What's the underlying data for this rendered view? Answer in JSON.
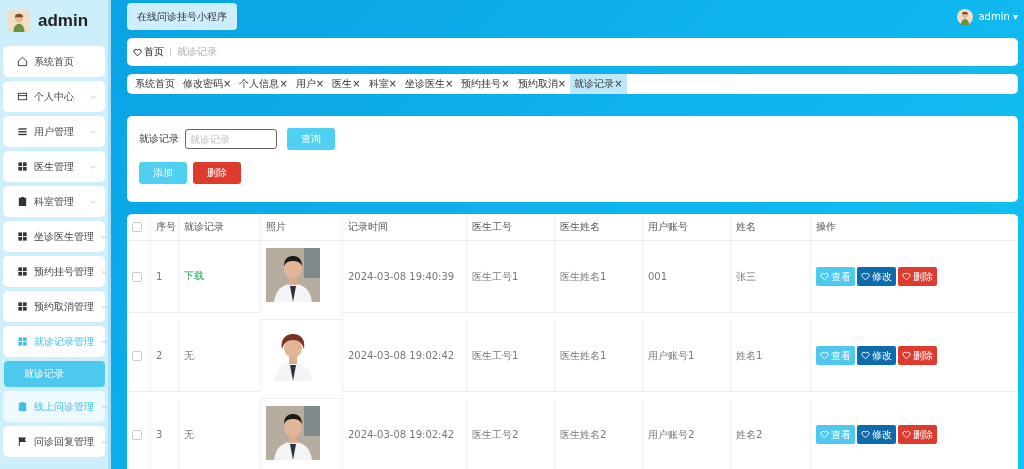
{
  "sidebar": {
    "user": "admin",
    "items": [
      {
        "label": "系统首页",
        "selected": false,
        "hovered": false
      },
      {
        "label": "个人中心",
        "selected": false,
        "hovered": false,
        "expanded": false
      },
      {
        "label": "用户管理",
        "selected": false,
        "hovered": false,
        "expanded": false
      },
      {
        "label": "医生管理",
        "selected": false,
        "hovered": false,
        "expanded": false
      },
      {
        "label": "科室管理",
        "selected": false,
        "hovered": false,
        "expanded": false
      },
      {
        "label": "坐诊医生管理",
        "selected": false,
        "hovered": false,
        "expanded": false
      },
      {
        "label": "预约挂号管理",
        "selected": false,
        "hovered": false,
        "expanded": false
      },
      {
        "label": "预约取消管理",
        "selected": false,
        "hovered": false,
        "expanded": false
      },
      {
        "label": "就诊记录管理",
        "selected": true,
        "hovered": false,
        "expanded": true,
        "children": [
          {
            "label": "就诊记录",
            "selected": true
          }
        ]
      },
      {
        "label": "线上问诊管理",
        "selected": false,
        "hovered": true,
        "expanded": false
      },
      {
        "label": "问诊回复管理",
        "selected": false,
        "hovered": false,
        "expanded": false
      }
    ]
  },
  "top_bar": {
    "title_button": "在线问诊挂号小程序",
    "user": "admin",
    "caret": "▾"
  },
  "breadcrumb": {
    "home": "首页",
    "current": "就诊记录"
  },
  "tags": [
    {
      "label": "系统首页",
      "selected": false
    },
    {
      "label": "修改密码",
      "close": "×",
      "selected": false
    },
    {
      "label": "个人信息",
      "close": "×",
      "selected": false
    },
    {
      "label": "用户",
      "close": "×",
      "selected": false
    },
    {
      "label": "医生",
      "close": "×",
      "selected": false
    },
    {
      "label": "科室",
      "close": "×",
      "selected": false
    },
    {
      "label": "坐诊医生",
      "close": "×",
      "selected": false
    },
    {
      "label": "预约挂号",
      "close": "×",
      "selected": false
    },
    {
      "label": "预约取消",
      "close": "×",
      "selected": false
    },
    {
      "label": "就诊记录",
      "close": "×",
      "selected": true
    }
  ],
  "search": {
    "label": "就诊记录",
    "placeholder": "就诊记录",
    "button": "查询",
    "add_button": "添加",
    "delete_button": "删除"
  },
  "table": {
    "all_checked": false,
    "columns": [
      "序号",
      "就诊记录",
      "照片",
      "记录时间",
      "医生工号",
      "医生姓名",
      "用户账号",
      "姓名",
      "操作"
    ],
    "rows": [
      {
        "checked": false,
        "index": "1",
        "record": {
          "text": "下载",
          "kind": "link"
        },
        "time": "2024-03-08 19:40:39",
        "doctor_no": "医生工号1",
        "doctor_name": "医生姓名1",
        "user_account": "001",
        "name": "张三",
        "actions": [
          "查看",
          "修改",
          "删除"
        ]
      },
      {
        "checked": false,
        "index": "2",
        "record": {
          "text": "无",
          "kind": "text"
        },
        "time": "2024-03-08 19:02:42",
        "doctor_no": "医生工号1",
        "doctor_name": "医生姓名1",
        "user_account": "用户账号1",
        "name": "姓名1",
        "actions": [
          "查看",
          "修改",
          "删除"
        ]
      },
      {
        "checked": false,
        "index": "3",
        "record": {
          "text": "无",
          "kind": "text"
        },
        "time": "2024-03-08 19:02:42",
        "doctor_no": "医生工号2",
        "doctor_name": "医生姓名2",
        "user_account": "用户账号2",
        "name": "姓名2",
        "actions": [
          "查看",
          "修改",
          "删除"
        ]
      }
    ]
  }
}
